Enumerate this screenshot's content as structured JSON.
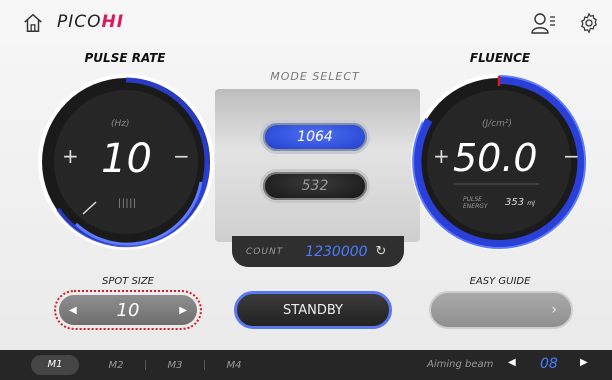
{
  "header": {
    "logo_prefix": "PICO",
    "logo_suffix": "HI"
  },
  "pulse": {
    "title": "PULSE RATE",
    "unit": "(Hz)",
    "value": "10",
    "minus": "−",
    "plus": "+",
    "mark": "│││││"
  },
  "mode": {
    "title": "MODE SELECT",
    "opt1": "1064",
    "opt2": "532",
    "count_label": "COUNT",
    "count_value": "1230000"
  },
  "fluence": {
    "title": "FLUENCE",
    "unit": "(J/cm²)",
    "value": "50.0",
    "minus": "−",
    "plus": "+",
    "pe_label1": "PULSE",
    "pe_label2": "ENERGY",
    "pe_value": "353",
    "pe_unit": "mJ"
  },
  "spot": {
    "title": "SPOT SIZE",
    "value": "10",
    "left": "◀",
    "right": "▶"
  },
  "standby": {
    "label": "STANDBY"
  },
  "guide": {
    "title": "EASY GUIDE",
    "arrow": "›"
  },
  "bottom": {
    "m1": "M1",
    "m2": "M2",
    "m3": "M3",
    "m4": "M4",
    "aim_label": "Aiming beam",
    "aim_value": "08",
    "left": "◀",
    "right": "▶"
  },
  "colors": {
    "accent": "#4a7bff",
    "brand": "#d81b60",
    "dial_blue": "#2a3fd6"
  }
}
